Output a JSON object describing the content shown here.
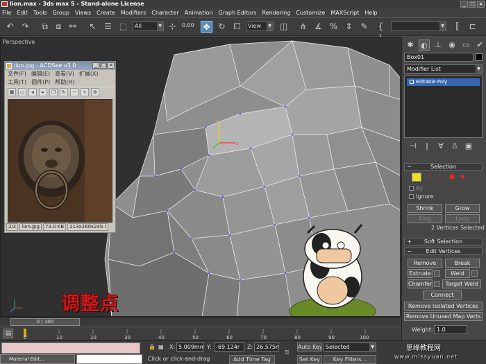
{
  "window": {
    "title": "lion.max - 3ds max 5 - Stand-alone License"
  },
  "menu": [
    "File",
    "Edit",
    "Tools",
    "Group",
    "Views",
    "Create",
    "Modifiers",
    "Character",
    "Animation",
    "Graph Editors",
    "Rendering",
    "Customize",
    "MAXScript",
    "Help"
  ],
  "toolbar": {
    "selection_filter": "All",
    "coord_system": "View",
    "snap_value": "0.00"
  },
  "viewport": {
    "label": "Perspective",
    "caption": "调整点"
  },
  "acdsee": {
    "title": "lion.jpg - ACDSee v3.0",
    "menu_row1": [
      "文件(F)",
      "编辑(E)",
      "查看(V)",
      "扩展(X)"
    ],
    "menu_row2": [
      "工具(T)",
      "插件(P)",
      "帮助(H)"
    ],
    "status": [
      "2/2",
      "lion.jpg",
      "73.0 KB",
      "213x260x24b i"
    ]
  },
  "panel": {
    "object_name": "Box01",
    "modifier_list": "Modifier List",
    "stack_item": "Editable Poly",
    "selection": {
      "title": "Selection",
      "by_label": "By",
      "ignore_label": "Ignore",
      "shrink": "Shrink",
      "grow": "Grow",
      "ring": "Ring",
      "loop": "Loop",
      "status": "2 Vertices Selected"
    },
    "soft_selection": {
      "title": "Soft Selection"
    },
    "edit_vertices": {
      "title": "Edit Vertices",
      "remove": "Remove",
      "break": "Break",
      "extrude": "Extrude",
      "weld": "Weld",
      "chamfer": "Chamfer",
      "target_weld": "Target Weld",
      "connect": "Connect",
      "remove_isolated": "Remove Isolated Vertices",
      "remove_unused": "Remove Unused Map Verts",
      "weight_label": "Weight:",
      "weight_value": "1.0"
    }
  },
  "timeline": {
    "frame": "0 / 100",
    "ticks": [
      "0",
      "10",
      "20",
      "30",
      "40",
      "50",
      "60",
      "70",
      "80",
      "90",
      "100"
    ]
  },
  "status": {
    "x_label": "X:",
    "x": "5.009mm",
    "y_label": "Y:",
    "y": "-69.124r",
    "z_label": "Z:",
    "z": "26.575m",
    "prompt": "Click or click-and-drag",
    "add_time_tag": "Add Time Tag",
    "auto_key": "Auto Key",
    "set_key": "Set Key",
    "selected": "Selected",
    "key_filters": "Key Filters..."
  },
  "taskbar": {
    "item": "Material Edit..."
  },
  "watermark": {
    "line1": "思缘教程网",
    "line2": "www.missyuan.net"
  }
}
